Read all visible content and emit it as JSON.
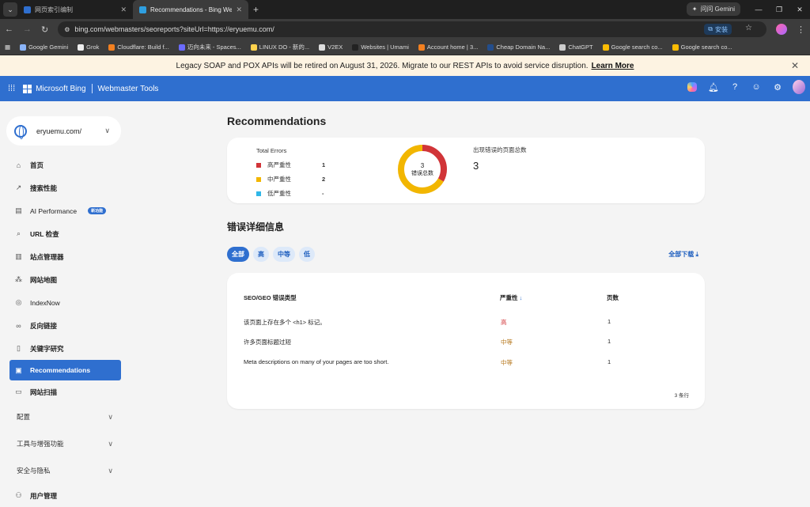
{
  "browser": {
    "tabs": [
      {
        "title": "网页索引编制",
        "active": false,
        "color": "#2f6fcf"
      },
      {
        "title": "Recommendations - Bing We",
        "active": true,
        "color": "#2f9fe0"
      }
    ],
    "gemini_chip": "问问 Gemini",
    "url": "bing.com/webmasters/seoreports?siteUrl=https://eryuemu.com/",
    "install_label": "安装",
    "bookmarks": [
      {
        "label": "Google Gemini",
        "color": "#8ab4f8"
      },
      {
        "label": "Grok",
        "color": "#eeeeee"
      },
      {
        "label": "Cloudflare: Build f...",
        "color": "#f38020"
      },
      {
        "label": "迈向未来 - Spaces...",
        "color": "#6b6bff"
      },
      {
        "label": "LINUX DO - 新的...",
        "color": "#ffd24d"
      },
      {
        "label": "V2EX",
        "color": "#dddddd"
      },
      {
        "label": "Websites | Umami",
        "color": "#222222"
      },
      {
        "label": "Account home | 3...",
        "color": "#f38020"
      },
      {
        "label": "Cheap Domain Na...",
        "color": "#234d8c"
      },
      {
        "label": "ChatGPT",
        "color": "#cccccc"
      },
      {
        "label": "Google search co...",
        "color": "#fbbc04"
      },
      {
        "label": "Google search co...",
        "color": "#fbbc04"
      }
    ]
  },
  "banner": {
    "text": "Legacy SOAP and POX APIs will be retired on August 31, 2026. Migrate to our REST APIs to avoid service disruption.",
    "link": "Learn More"
  },
  "header": {
    "brand": "Microsoft Bing",
    "product": "Webmaster Tools"
  },
  "sidebar": {
    "site": "eryuemu.com/",
    "items": [
      {
        "label": "首页",
        "icon": "⌂"
      },
      {
        "label": "搜索性能",
        "icon": "↗"
      },
      {
        "label": "AI Performance",
        "icon": "▤",
        "badge": "新功能"
      },
      {
        "label": "URL 检查",
        "icon": "⌕"
      },
      {
        "label": "站点管理器",
        "icon": "▥"
      },
      {
        "label": "网站地图",
        "icon": "⁂"
      },
      {
        "label": "IndexNow",
        "icon": "◎"
      },
      {
        "label": "反向链接",
        "icon": "∞"
      },
      {
        "label": "关键字研究",
        "icon": "▯"
      },
      {
        "label": "Recommendations",
        "icon": "▣",
        "active": true
      },
      {
        "label": "网站扫描",
        "icon": "▭"
      }
    ],
    "groups": [
      "配置",
      "工具与增强功能",
      "安全与隐私"
    ],
    "user_mgmt": "用户管理"
  },
  "main": {
    "title": "Recommendations",
    "total_errors_label": "Total Errors",
    "severity": [
      {
        "label": "高严重性",
        "count": "1",
        "color": "#d13438"
      },
      {
        "label": "中严重性",
        "count": "2",
        "color": "#f2b600"
      },
      {
        "label": "低严重性",
        "count": "-",
        "color": "#30b7e8"
      }
    ],
    "donut": {
      "total": "3",
      "label": "错误总数",
      "high": 1,
      "medium": 2,
      "low": 0
    },
    "pages_label": "出现错误的页面总数",
    "pages_count": "3",
    "details_title": "错误详细信息",
    "filters": [
      "全部",
      "高",
      "中等",
      "低"
    ],
    "download_all": "全部下载",
    "table": {
      "headers": [
        "SEO/GEO 错误类型",
        "严重性",
        "页数"
      ],
      "rows": [
        {
          "type": "该页面上存在多个 <h1> 标记。",
          "severity": "高",
          "level": "high",
          "pages": "1"
        },
        {
          "type": "许多页面标题过短",
          "severity": "中等",
          "level": "medium",
          "pages": "1"
        },
        {
          "type": "Meta descriptions on many of your pages are too short.",
          "severity": "中等",
          "level": "medium",
          "pages": "1"
        }
      ],
      "row_count": "3 条行"
    }
  }
}
